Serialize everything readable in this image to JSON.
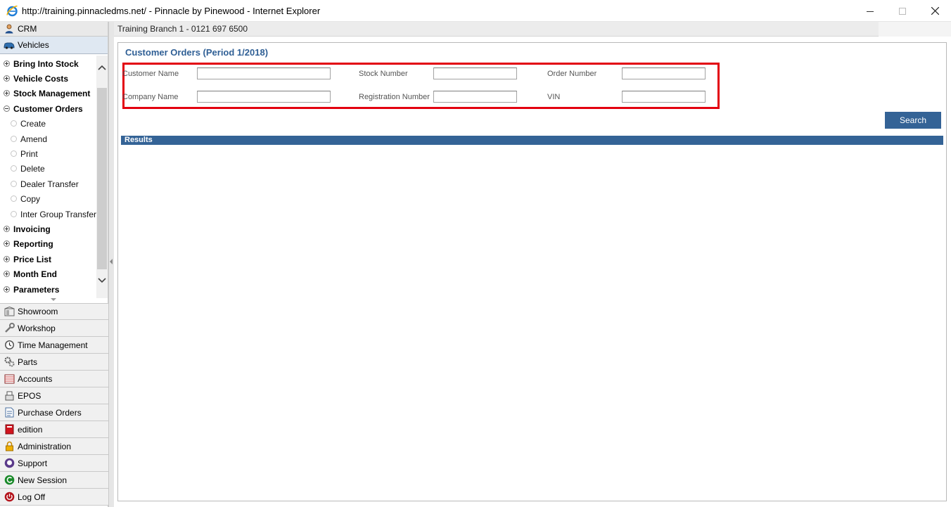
{
  "window": {
    "title": "http://training.pinnacledms.net/ - Pinnacle by Pinewood - Internet Explorer"
  },
  "nav": {
    "crm": "CRM",
    "vehicles": "Vehicles",
    "tree": [
      {
        "label": "Bring Into Stock",
        "type": "group",
        "expanded": false
      },
      {
        "label": "Vehicle Costs",
        "type": "group",
        "expanded": false
      },
      {
        "label": "Stock Management",
        "type": "group",
        "expanded": false
      },
      {
        "label": "Customer Orders",
        "type": "group",
        "expanded": true
      },
      {
        "label": "Create",
        "type": "item"
      },
      {
        "label": "Amend",
        "type": "item"
      },
      {
        "label": "Print",
        "type": "item"
      },
      {
        "label": "Delete",
        "type": "item"
      },
      {
        "label": "Dealer Transfer",
        "type": "item"
      },
      {
        "label": "Copy",
        "type": "item"
      },
      {
        "label": "Inter Group Transfer",
        "type": "item"
      },
      {
        "label": "Invoicing",
        "type": "group",
        "expanded": false
      },
      {
        "label": "Reporting",
        "type": "group",
        "expanded": false
      },
      {
        "label": "Price List",
        "type": "group",
        "expanded": false
      },
      {
        "label": "Month End",
        "type": "group",
        "expanded": false
      },
      {
        "label": "Parameters",
        "type": "group",
        "expanded": false
      }
    ],
    "modules": [
      {
        "label": "Showroom",
        "icon": "showroom-icon"
      },
      {
        "label": "Workshop",
        "icon": "wrench-icon"
      },
      {
        "label": "Time Management",
        "icon": "clock-icon"
      },
      {
        "label": "Parts",
        "icon": "gears-icon"
      },
      {
        "label": "Accounts",
        "icon": "ledger-icon"
      },
      {
        "label": "EPOS",
        "icon": "till-icon"
      },
      {
        "label": "Purchase Orders",
        "icon": "document-icon"
      },
      {
        "label": "edition",
        "icon": "book-icon"
      },
      {
        "label": "Administration",
        "icon": "lock-icon"
      },
      {
        "label": "Support",
        "icon": "support-icon"
      },
      {
        "label": "New Session",
        "icon": "refresh-icon"
      },
      {
        "label": "Log Off",
        "icon": "power-icon"
      }
    ]
  },
  "header": {
    "branch": "Training Branch 1 - 0121 697 6500"
  },
  "main": {
    "title": "Customer Orders (Period 1/2018)",
    "fields": {
      "customer_name": {
        "label": "Customer Name",
        "value": ""
      },
      "stock_number": {
        "label": "Stock Number",
        "value": ""
      },
      "order_number": {
        "label": "Order Number",
        "value": ""
      },
      "company_name": {
        "label": "Company Name",
        "value": ""
      },
      "registration_number": {
        "label": "Registration Number",
        "value": ""
      },
      "vin": {
        "label": "VIN",
        "value": ""
      }
    },
    "search_label": "Search",
    "results_label": "Results"
  },
  "colors": {
    "accent": "#346396",
    "title_text": "#2f5f95",
    "highlight": "#e3000f"
  }
}
